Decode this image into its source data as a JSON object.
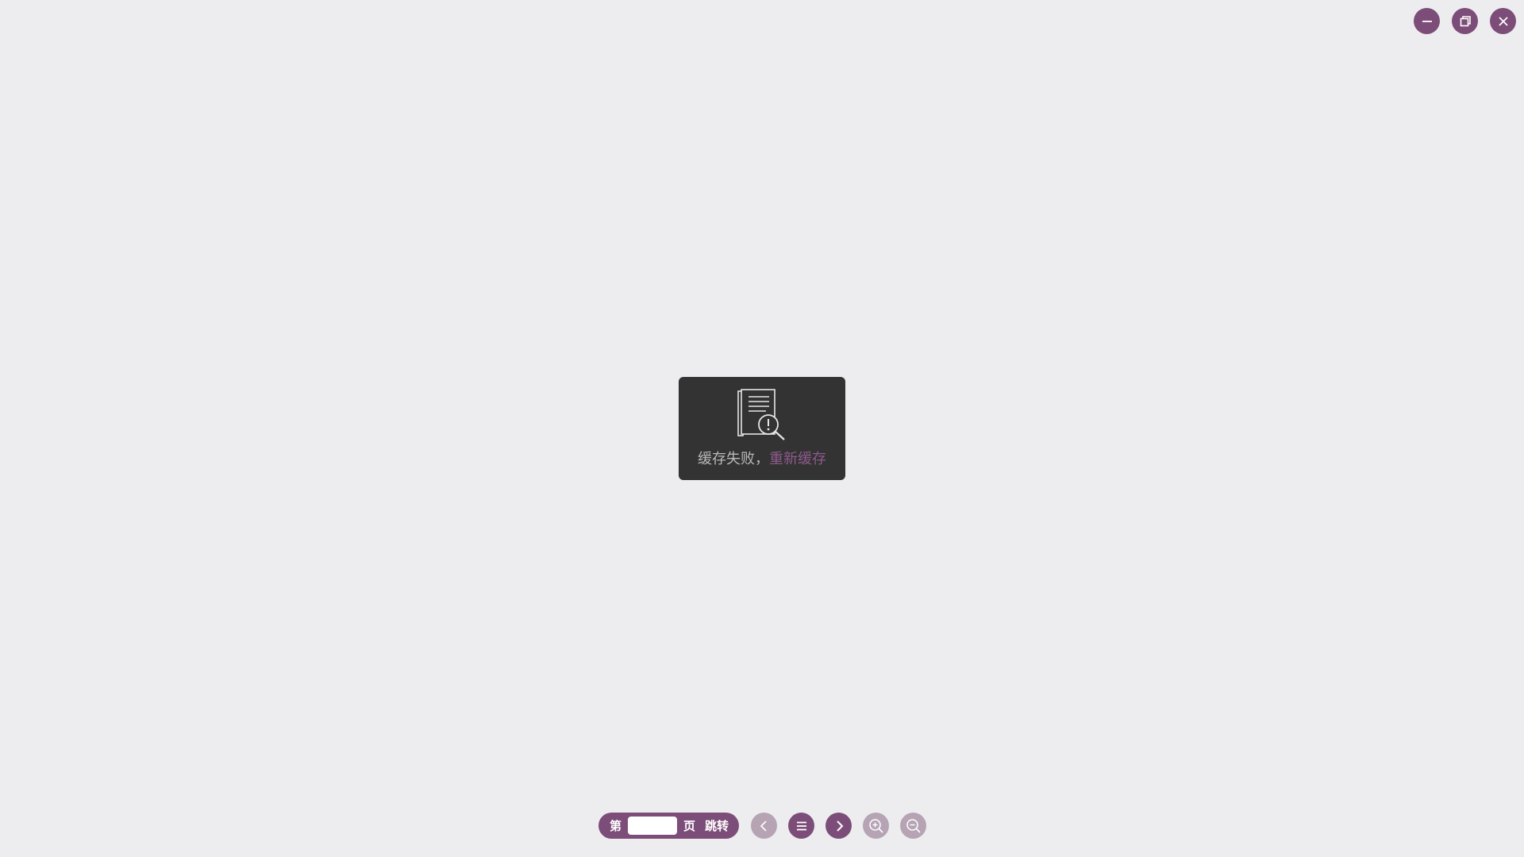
{
  "window_controls": {
    "minimize_icon": "minus-icon",
    "restore_icon": "restore-icon",
    "close_icon": "close-icon"
  },
  "toast": {
    "icon": "document-search-warning-icon",
    "message": "缓存失败，",
    "retry_link": "重新缓存"
  },
  "toolbar": {
    "page_prefix": "第",
    "page_input_value": "",
    "page_suffix": "页",
    "jump_label": "跳转",
    "prev_icon": "chevron-left-icon",
    "menu_icon": "list-menu-icon",
    "next_icon": "chevron-right-icon",
    "zoom_in_icon": "zoom-in-icon",
    "zoom_out_icon": "zoom-out-icon"
  },
  "colors": {
    "accent": "#7c4d79",
    "disabled": "#b6a4b5",
    "background": "#ededef",
    "toast_bg": "#333333",
    "link": "#8f5a8c"
  }
}
